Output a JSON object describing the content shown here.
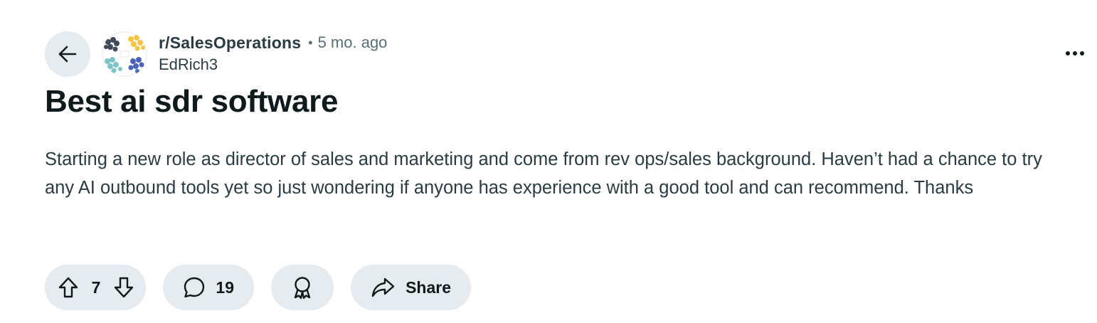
{
  "post": {
    "subreddit": "r/SalesOperations",
    "separator": "•",
    "time_ago": "5 mo. ago",
    "author": "EdRich3",
    "title": "Best ai sdr software",
    "body": "Starting a new role as director of sales and marketing and come from rev ops/sales background. Haven’t had a chance to try any AI outbound tools yet so just wondering if anyone has experience with a good tool and can recommend. Thanks"
  },
  "actions": {
    "vote_count": "7",
    "comment_count": "19",
    "share_label": "Share"
  },
  "icons": {
    "back": "arrow-left-icon",
    "more": "ellipsis-icon",
    "upvote": "arrow-up-icon",
    "downvote": "arrow-down-icon",
    "comment": "speech-bubble-icon",
    "award": "award-ribbon-icon",
    "share": "share-arrow-icon"
  },
  "colors": {
    "pill_background": "#e5ebee",
    "text_primary": "#0f1a1c",
    "text_secondary": "#576f76",
    "avatar_dark": "#3f4b58",
    "avatar_yellow": "#f5c542",
    "avatar_teal": "#7fc4c9",
    "avatar_blue": "#4a63b8"
  }
}
